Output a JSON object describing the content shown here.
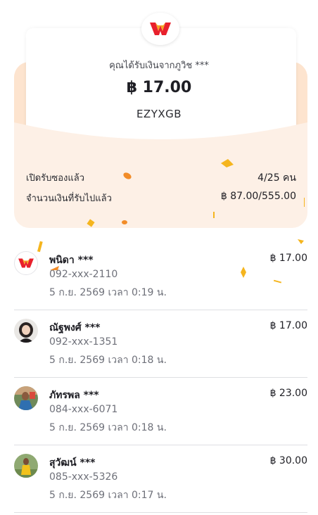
{
  "header": {
    "sender_label": "คุณได้รับเงินจากภูวิช ***",
    "amount": "฿ 17.00",
    "code": "EZYXGB",
    "opened_label": "เปิดรับซองแล้ว",
    "opened_value": "4/25 คน",
    "received_label": "จำนวนเงินที่รับไปแล้ว",
    "received_value": "฿ 87.00/555.00"
  },
  "colors": {
    "envelope_bg": "#fdf0e6",
    "envelope_flap": "#fde4cf",
    "brand_red": "#e8202c",
    "brand_orange": "#f6a623",
    "confetti_orange": "#f28c28",
    "confetti_yellow": "#f5b51e"
  },
  "recipients": [
    {
      "name": "พนิดา ***",
      "phone": "092-xxx-2110",
      "time": "5 ก.ย. 2569 เวลา 0:19 น.",
      "amount": "฿ 17.00",
      "avatar": "brand-logo"
    },
    {
      "name": "ณัฐพงศ์ ***",
      "phone": "092-xxx-1351",
      "time": "5 ก.ย. 2569 เวลา 0:18 น.",
      "amount": "฿ 17.00",
      "avatar": "photo-person"
    },
    {
      "name": "ภัทรพล ***",
      "phone": "084-xxx-6071",
      "time": "5 ก.ย. 2569 เวลา 0:18 น.",
      "amount": "฿ 23.00",
      "avatar": "photo-person"
    },
    {
      "name": "สุวัฒน์ ***",
      "phone": "085-xxx-5326",
      "time": "5 ก.ย. 2569 เวลา 0:17 น.",
      "amount": "฿ 30.00",
      "avatar": "photo-person"
    }
  ]
}
